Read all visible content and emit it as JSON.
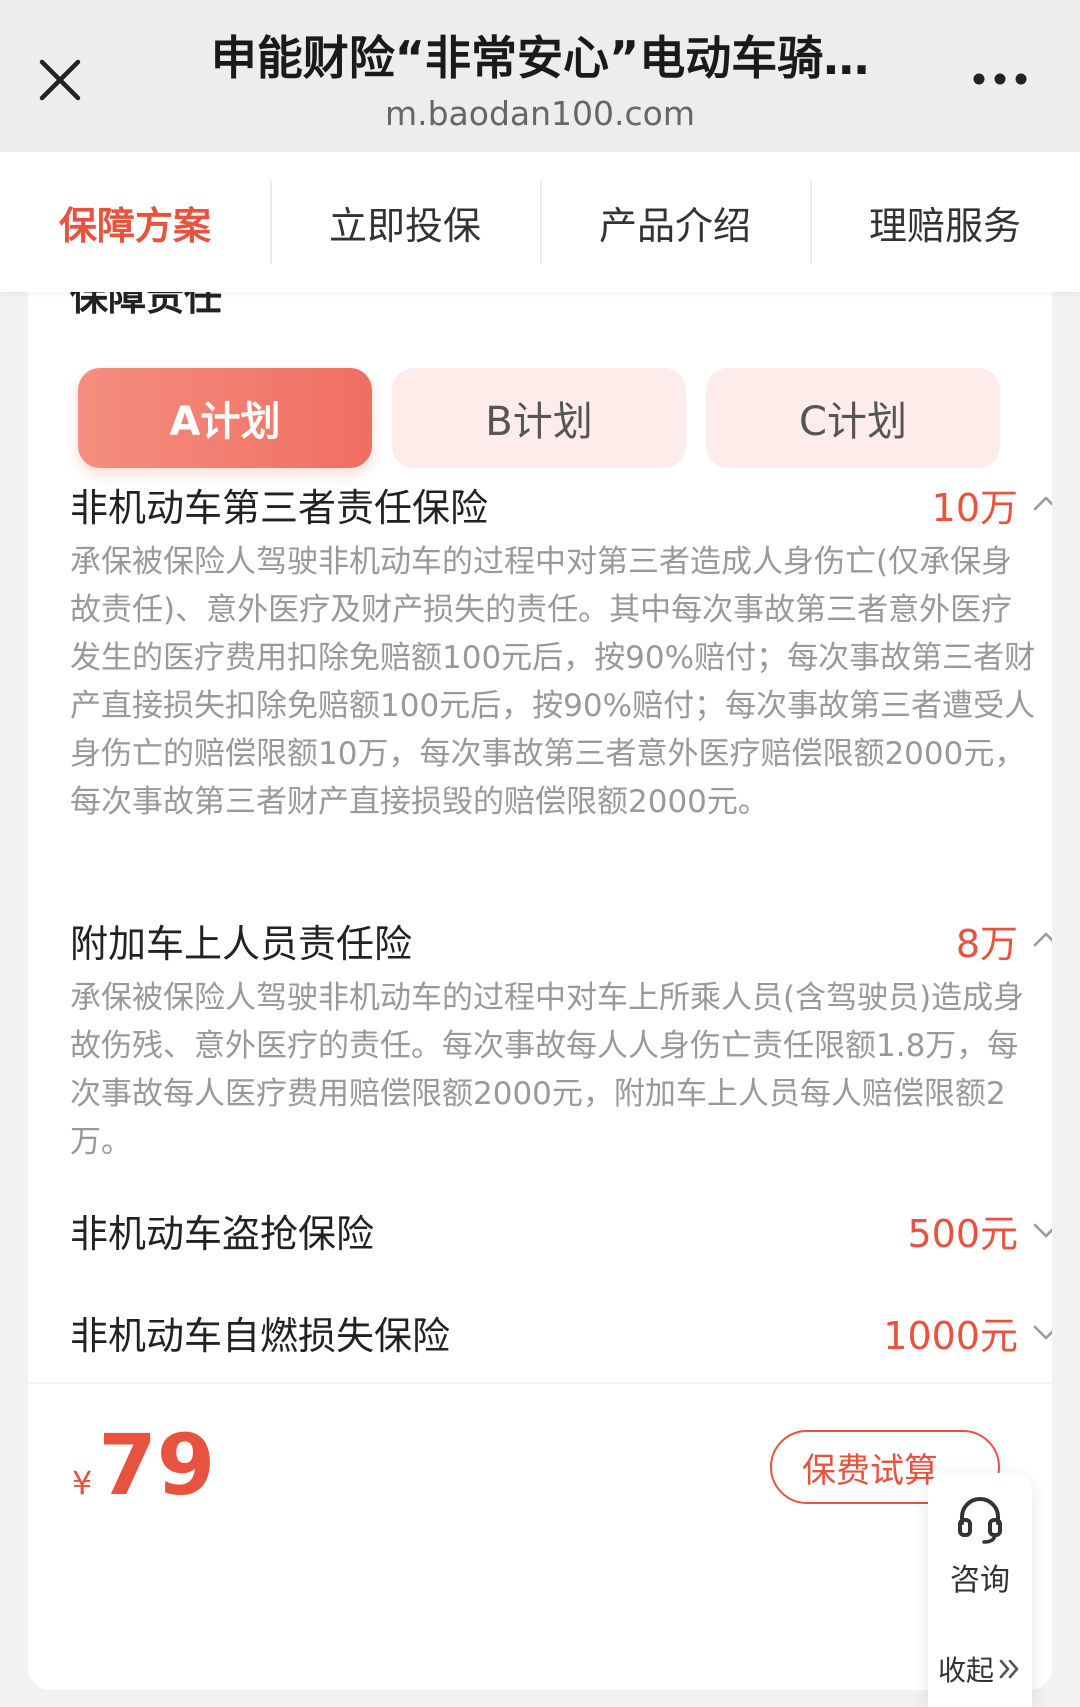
{
  "topbar": {
    "title": "申能财险“非常安心”电动车骑…",
    "url": "m.baodan100.com",
    "icons": {
      "close": "close-icon",
      "more": "more-dots-icon"
    }
  },
  "tabs": [
    {
      "label": "保障方案",
      "active": true
    },
    {
      "label": "立即投保",
      "active": false
    },
    {
      "label": "产品介绍",
      "active": false
    },
    {
      "label": "理赔服务",
      "active": false
    }
  ],
  "section": {
    "title": "保障责任"
  },
  "plans": [
    {
      "label": "A计划",
      "active": true
    },
    {
      "label": "B计划",
      "active": false
    },
    {
      "label": "C计划",
      "active": false
    }
  ],
  "items": [
    {
      "name": "非机动车第三者责任保险",
      "amount": "10万",
      "expanded": true,
      "desc": "承保被保险人驾驶非机动车的过程中对第三者造成人身伤亡(仅承保身故责任)、意外医疗及财产损失的责任。其中每次事故第三者意外医疗发生的医疗费用扣除免赔额100元后，按90%赔付；每次事故第三者财产直接损失扣除免赔额100元后，按90%赔付；每次事故第三者遭受人身伤亡的赔偿限额10万，每次事故第三者意外医疗赔偿限额2000元，每次事故第三者财产直接损毁的赔偿限额2000元。"
    },
    {
      "name": "附加车上人员责任险",
      "amount": "8万",
      "expanded": true,
      "desc": "承保被保险人驾驶非机动车的过程中对车上所乘人员(含驾驶员)造成身故伤残、意外医疗的责任。每次事故每人人身伤亡责任限额1.8万，每次事故每人医疗费用赔偿限额2000元，附加车上人员每人赔偿限额2万。"
    },
    {
      "name": "非机动车盗抢保险",
      "amount": "500元",
      "expanded": false
    },
    {
      "name": "非机动车自燃损失保险",
      "amount": "1000元",
      "expanded": false
    }
  ],
  "footer": {
    "currency": "¥",
    "price": "79",
    "calc_button": "保费试算"
  },
  "float_panel": {
    "consult_label": "咨询",
    "consult_icon": "headset-icon",
    "collapse_label": "收起",
    "collapse_icon": "double-chevron-right-icon"
  },
  "colors": {
    "accent": "#e8533f",
    "plan_active_start": "#f58e80",
    "plan_active_end": "#ef6f61",
    "plan_inactive_bg": "#fdecea",
    "desc_text": "#999999"
  }
}
